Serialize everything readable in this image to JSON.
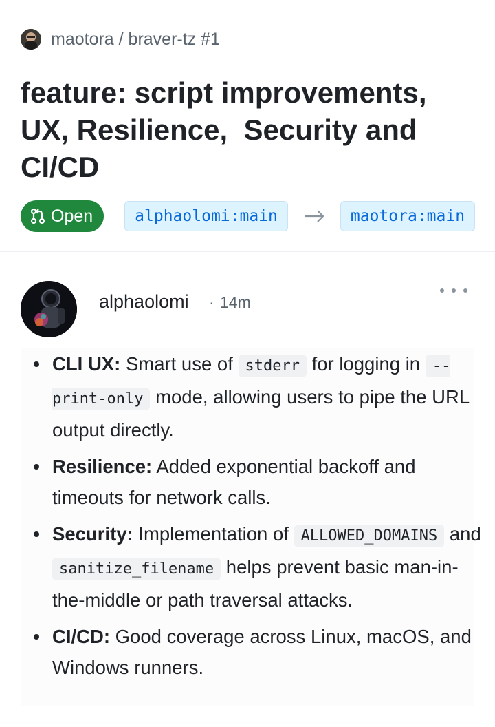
{
  "header": {
    "repo_path": "maotora / braver-tz #1",
    "title": "feature: script improvements, UX, Resilience,  Security and CI/CD",
    "state": {
      "label": "Open",
      "icon": "git-pull-request-icon",
      "color": "#1f883d"
    },
    "head_branch": "alphaolomi:main",
    "base_branch": "maotora:main"
  },
  "comment": {
    "author": "alphaolomi",
    "separator": "·",
    "time": "14m",
    "items": [
      {
        "label": "CLI UX:",
        "parts": [
          " Smart use of ",
          "stderr",
          " for logging in ",
          "--print-only",
          " mode, allowing users to pipe the URL output directly."
        ]
      },
      {
        "label": "Resilience:",
        "parts": [
          " Added exponential backoff and timeouts for network calls."
        ]
      },
      {
        "label": "Security:",
        "parts": [
          " Implementation of ",
          "ALLOWED_DOMAINS",
          " and ",
          "sanitize_filename",
          " helps prevent basic man-in-the-middle or path traversal attacks."
        ]
      },
      {
        "label": "CI/CD:",
        "parts": [
          " Good coverage across Linux, macOS, and Windows runners."
        ]
      }
    ]
  },
  "colors": {
    "open_green": "#1f883d",
    "branch_bg": "#ddf4ff",
    "branch_text": "#0969da",
    "code_bg": "#eff1f3"
  }
}
